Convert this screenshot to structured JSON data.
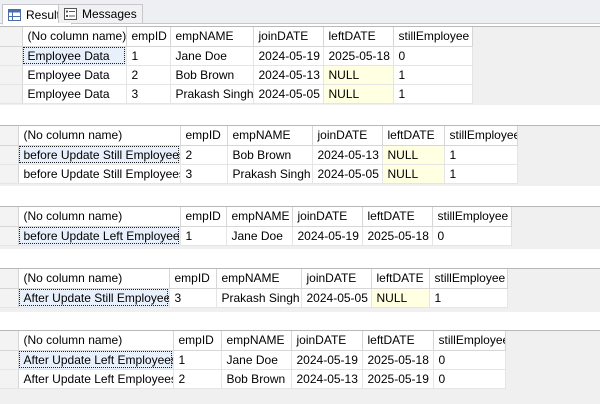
{
  "tabs": [
    {
      "label": "Results",
      "icon": "grid-icon"
    },
    {
      "label": "Messages",
      "icon": "messages-icon"
    }
  ],
  "columns_common": [
    "(No column name)",
    "empID",
    "empNAME",
    "joinDATE",
    "leftDATE",
    "stillEmployee"
  ],
  "results": [
    {
      "rows": [
        [
          "Employee Data",
          "1",
          "Jane Doe",
          "2024-05-19",
          "2025-05-18",
          "0"
        ],
        [
          "Employee Data",
          "2",
          "Bob Brown",
          "2024-05-13",
          "NULL",
          "1"
        ],
        [
          "Employee Data",
          "3",
          "Prakash Singh",
          "2024-05-05",
          "NULL",
          "1"
        ]
      ]
    },
    {
      "rows": [
        [
          "before Update Still Employees",
          "2",
          "Bob Brown",
          "2024-05-13",
          "NULL",
          "1"
        ],
        [
          "before Update Still Employees",
          "3",
          "Prakash Singh",
          "2024-05-05",
          "NULL",
          "1"
        ]
      ]
    },
    {
      "rows": [
        [
          "before Update Left Employees",
          "1",
          "Jane Doe",
          "2024-05-19",
          "2025-05-18",
          "0"
        ]
      ]
    },
    {
      "rows": [
        [
          "After Update Still Employees",
          "3",
          "Prakash Singh",
          "2024-05-05",
          "NULL",
          "1"
        ]
      ]
    },
    {
      "rows": [
        [
          "After Update Left  Employees",
          "1",
          "Jane Doe",
          "2024-05-19",
          "2025-05-18",
          "0"
        ],
        [
          "After Update Left  Employees",
          "2",
          "Bob Brown",
          "2024-05-13",
          "2025-05-19",
          "0"
        ]
      ]
    }
  ],
  "colors": {
    "null_bg": "#ffffe1",
    "grid_bg": "#f0f0f0",
    "tabbar_bg": "#eeeff2"
  }
}
